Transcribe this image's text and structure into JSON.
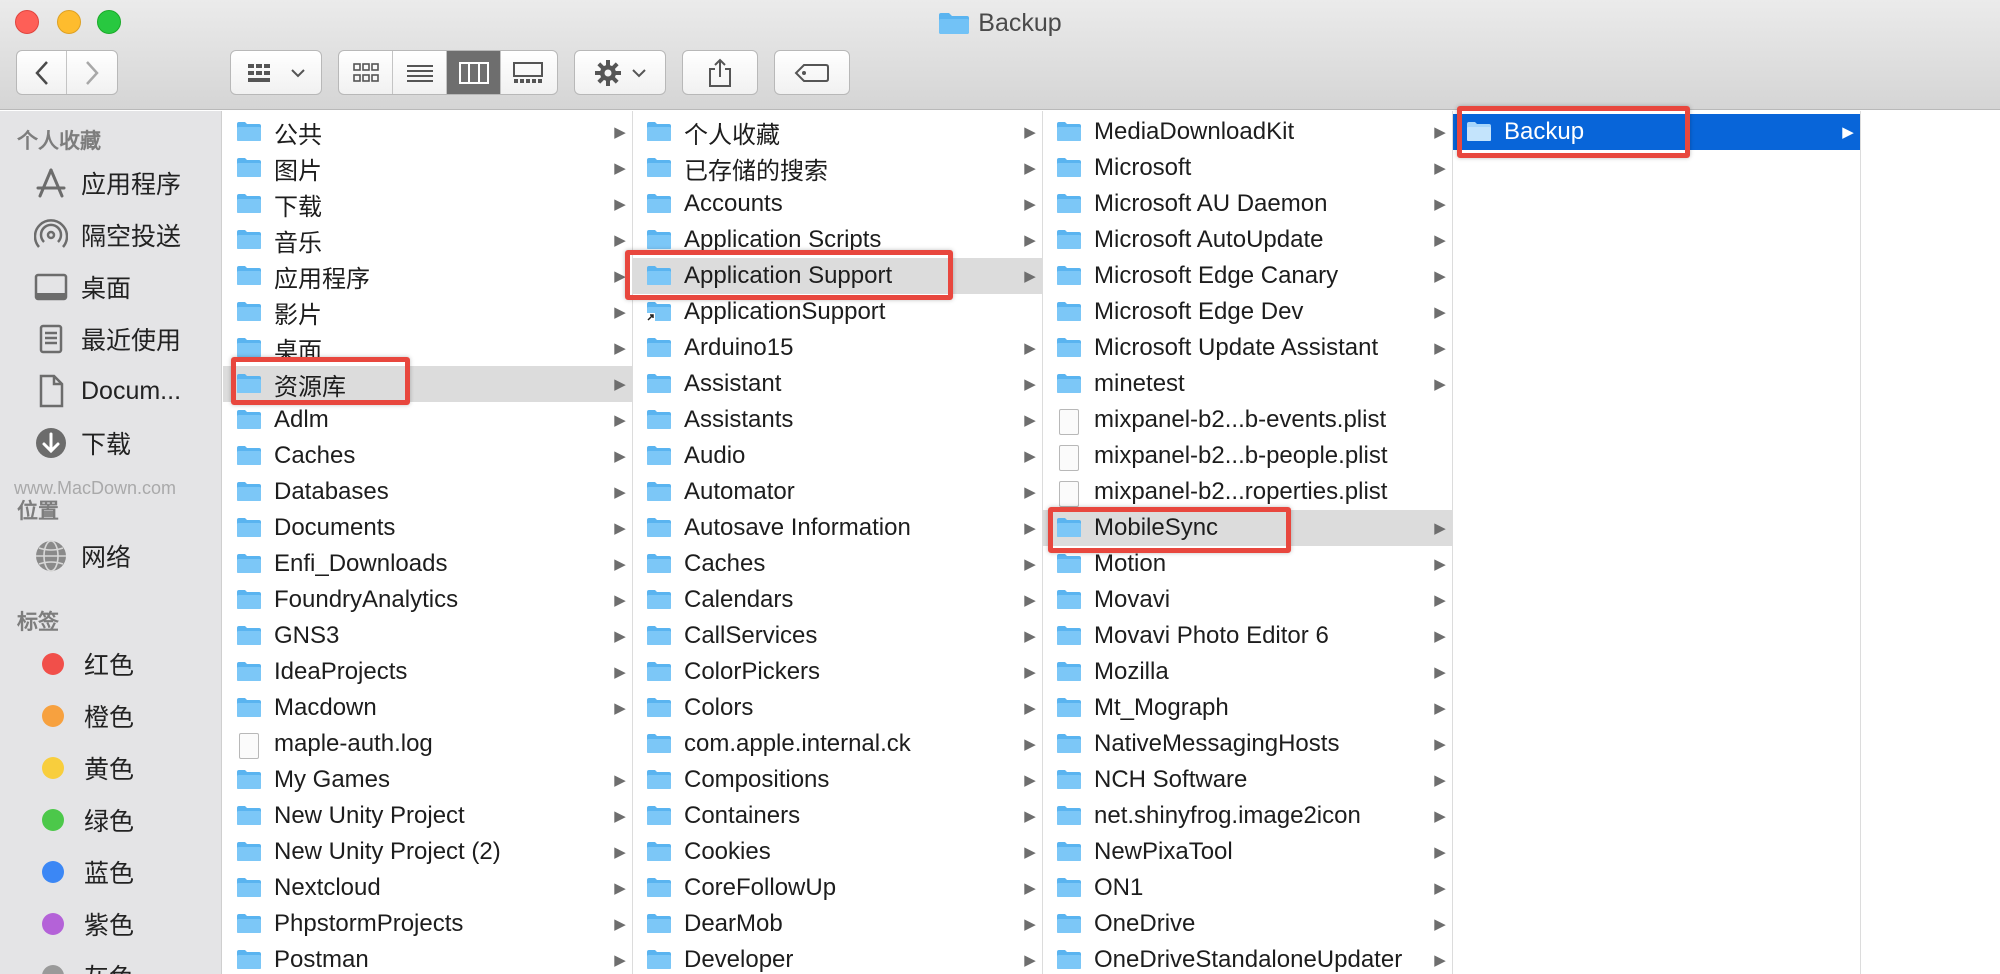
{
  "window": {
    "title": "Backup"
  },
  "sidebar": {
    "sections": [
      {
        "title": "个人收藏",
        "items": [
          {
            "label": "应用程序",
            "icon": "applications-icon"
          },
          {
            "label": "隔空投送",
            "icon": "airdrop-icon"
          },
          {
            "label": "桌面",
            "icon": "desktop-icon"
          },
          {
            "label": "最近使用",
            "icon": "recents-icon"
          },
          {
            "label": "Docum...",
            "icon": "documents-icon"
          },
          {
            "label": "下载",
            "icon": "downloads-icon"
          }
        ]
      },
      {
        "title": "位置",
        "items": [
          {
            "label": "网络",
            "icon": "network-icon"
          }
        ]
      },
      {
        "title": "标签",
        "tags": [
          {
            "label": "红色",
            "color": "#f14f4a"
          },
          {
            "label": "橙色",
            "color": "#f7a13f"
          },
          {
            "label": "黄色",
            "color": "#f8ce3d"
          },
          {
            "label": "绿色",
            "color": "#4cc84a"
          },
          {
            "label": "蓝色",
            "color": "#3b87f5"
          },
          {
            "label": "紫色",
            "color": "#b462d8"
          },
          {
            "label": "灰色",
            "color": "#9a9a9a"
          }
        ]
      }
    ]
  },
  "columns": [
    {
      "items": [
        {
          "name": "公共",
          "type": "folder",
          "arrow": true
        },
        {
          "name": "图片",
          "type": "folder",
          "arrow": true
        },
        {
          "name": "下载",
          "type": "folder",
          "arrow": true
        },
        {
          "name": "音乐",
          "type": "folder",
          "arrow": true
        },
        {
          "name": "应用程序",
          "type": "folder",
          "arrow": true
        },
        {
          "name": "影片",
          "type": "folder",
          "arrow": true
        },
        {
          "name": "桌面",
          "type": "folder",
          "arrow": true
        },
        {
          "name": "资源库",
          "type": "folder",
          "arrow": true,
          "selected": "gray"
        },
        {
          "name": "Adlm",
          "type": "folder",
          "arrow": true
        },
        {
          "name": "Caches",
          "type": "folder",
          "arrow": true
        },
        {
          "name": "Databases",
          "type": "folder",
          "arrow": true
        },
        {
          "name": "Documents",
          "type": "folder",
          "arrow": true
        },
        {
          "name": "Enfi_Downloads",
          "type": "folder",
          "arrow": true
        },
        {
          "name": "FoundryAnalytics",
          "type": "folder",
          "arrow": true
        },
        {
          "name": "GNS3",
          "type": "folder",
          "arrow": true
        },
        {
          "name": "IdeaProjects",
          "type": "folder",
          "arrow": true
        },
        {
          "name": "Macdown",
          "type": "folder",
          "arrow": true
        },
        {
          "name": "maple-auth.log",
          "type": "file",
          "arrow": false
        },
        {
          "name": "My Games",
          "type": "folder",
          "arrow": true
        },
        {
          "name": "New Unity Project",
          "type": "folder",
          "arrow": true
        },
        {
          "name": "New Unity Project (2)",
          "type": "folder",
          "arrow": true
        },
        {
          "name": "Nextcloud",
          "type": "folder",
          "arrow": true
        },
        {
          "name": "PhpstormProjects",
          "type": "folder",
          "arrow": true
        },
        {
          "name": "Postman",
          "type": "folder",
          "arrow": true
        }
      ]
    },
    {
      "items": [
        {
          "name": "个人收藏",
          "type": "folder",
          "arrow": true
        },
        {
          "name": "已存储的搜索",
          "type": "folder",
          "arrow": true
        },
        {
          "name": "Accounts",
          "type": "folder",
          "arrow": true
        },
        {
          "name": "Application Scripts",
          "type": "folder",
          "arrow": true
        },
        {
          "name": "Application Support",
          "type": "folder",
          "arrow": true,
          "selected": "gray"
        },
        {
          "name": "ApplicationSupport",
          "type": "alias",
          "arrow": false
        },
        {
          "name": "Arduino15",
          "type": "folder",
          "arrow": true
        },
        {
          "name": "Assistant",
          "type": "folder",
          "arrow": true
        },
        {
          "name": "Assistants",
          "type": "folder",
          "arrow": true
        },
        {
          "name": "Audio",
          "type": "folder",
          "arrow": true
        },
        {
          "name": "Automator",
          "type": "folder",
          "arrow": true
        },
        {
          "name": "Autosave Information",
          "type": "folder",
          "arrow": true
        },
        {
          "name": "Caches",
          "type": "folder",
          "arrow": true
        },
        {
          "name": "Calendars",
          "type": "folder",
          "arrow": true
        },
        {
          "name": "CallServices",
          "type": "folder",
          "arrow": true
        },
        {
          "name": "ColorPickers",
          "type": "folder",
          "arrow": true
        },
        {
          "name": "Colors",
          "type": "folder",
          "arrow": true
        },
        {
          "name": "com.apple.internal.ck",
          "type": "folder",
          "arrow": true
        },
        {
          "name": "Compositions",
          "type": "folder",
          "arrow": true
        },
        {
          "name": "Containers",
          "type": "folder",
          "arrow": true
        },
        {
          "name": "Cookies",
          "type": "folder",
          "arrow": true
        },
        {
          "name": "CoreFollowUp",
          "type": "folder",
          "arrow": true
        },
        {
          "name": "DearMob",
          "type": "folder",
          "arrow": true
        },
        {
          "name": "Developer",
          "type": "folder",
          "arrow": true
        }
      ]
    },
    {
      "items": [
        {
          "name": "MediaDownloadKit",
          "type": "folder",
          "arrow": true
        },
        {
          "name": "Microsoft",
          "type": "folder",
          "arrow": true
        },
        {
          "name": "Microsoft AU Daemon",
          "type": "folder",
          "arrow": true
        },
        {
          "name": "Microsoft AutoUpdate",
          "type": "folder",
          "arrow": true
        },
        {
          "name": "Microsoft Edge Canary",
          "type": "folder",
          "arrow": true
        },
        {
          "name": "Microsoft Edge Dev",
          "type": "folder",
          "arrow": true
        },
        {
          "name": "Microsoft Update Assistant",
          "type": "folder",
          "arrow": true
        },
        {
          "name": "minetest",
          "type": "folder",
          "arrow": true
        },
        {
          "name": "mixpanel-b2...b-events.plist",
          "type": "file",
          "arrow": false
        },
        {
          "name": "mixpanel-b2...b-people.plist",
          "type": "file",
          "arrow": false
        },
        {
          "name": "mixpanel-b2...roperties.plist",
          "type": "file",
          "arrow": false
        },
        {
          "name": "MobileSync",
          "type": "folder",
          "arrow": true,
          "selected": "gray"
        },
        {
          "name": "Motion",
          "type": "folder",
          "arrow": true
        },
        {
          "name": "Movavi",
          "type": "folder",
          "arrow": true
        },
        {
          "name": "Movavi Photo Editor 6",
          "type": "folder",
          "arrow": true
        },
        {
          "name": "Mozilla",
          "type": "folder",
          "arrow": true
        },
        {
          "name": "Mt_Mograph",
          "type": "folder",
          "arrow": true
        },
        {
          "name": "NativeMessagingHosts",
          "type": "folder",
          "arrow": true
        },
        {
          "name": "NCH Software",
          "type": "folder",
          "arrow": true
        },
        {
          "name": "net.shinyfrog.image2icon",
          "type": "folder",
          "arrow": true
        },
        {
          "name": "NewPixaTool",
          "type": "folder",
          "arrow": true
        },
        {
          "name": "ON1",
          "type": "folder",
          "arrow": true
        },
        {
          "name": "OneDrive",
          "type": "folder",
          "arrow": true
        },
        {
          "name": "OneDriveStandaloneUpdater",
          "type": "folder",
          "arrow": true
        }
      ]
    },
    {
      "items": [
        {
          "name": "Backup",
          "type": "folder",
          "arrow": true,
          "selected": "blue"
        }
      ]
    }
  ],
  "watermark": "www.MacDown.com",
  "colors": {
    "highlight_box": "#e8473e",
    "selection_blue": "#0865d9",
    "folder_blue": "#5ab4f0"
  }
}
